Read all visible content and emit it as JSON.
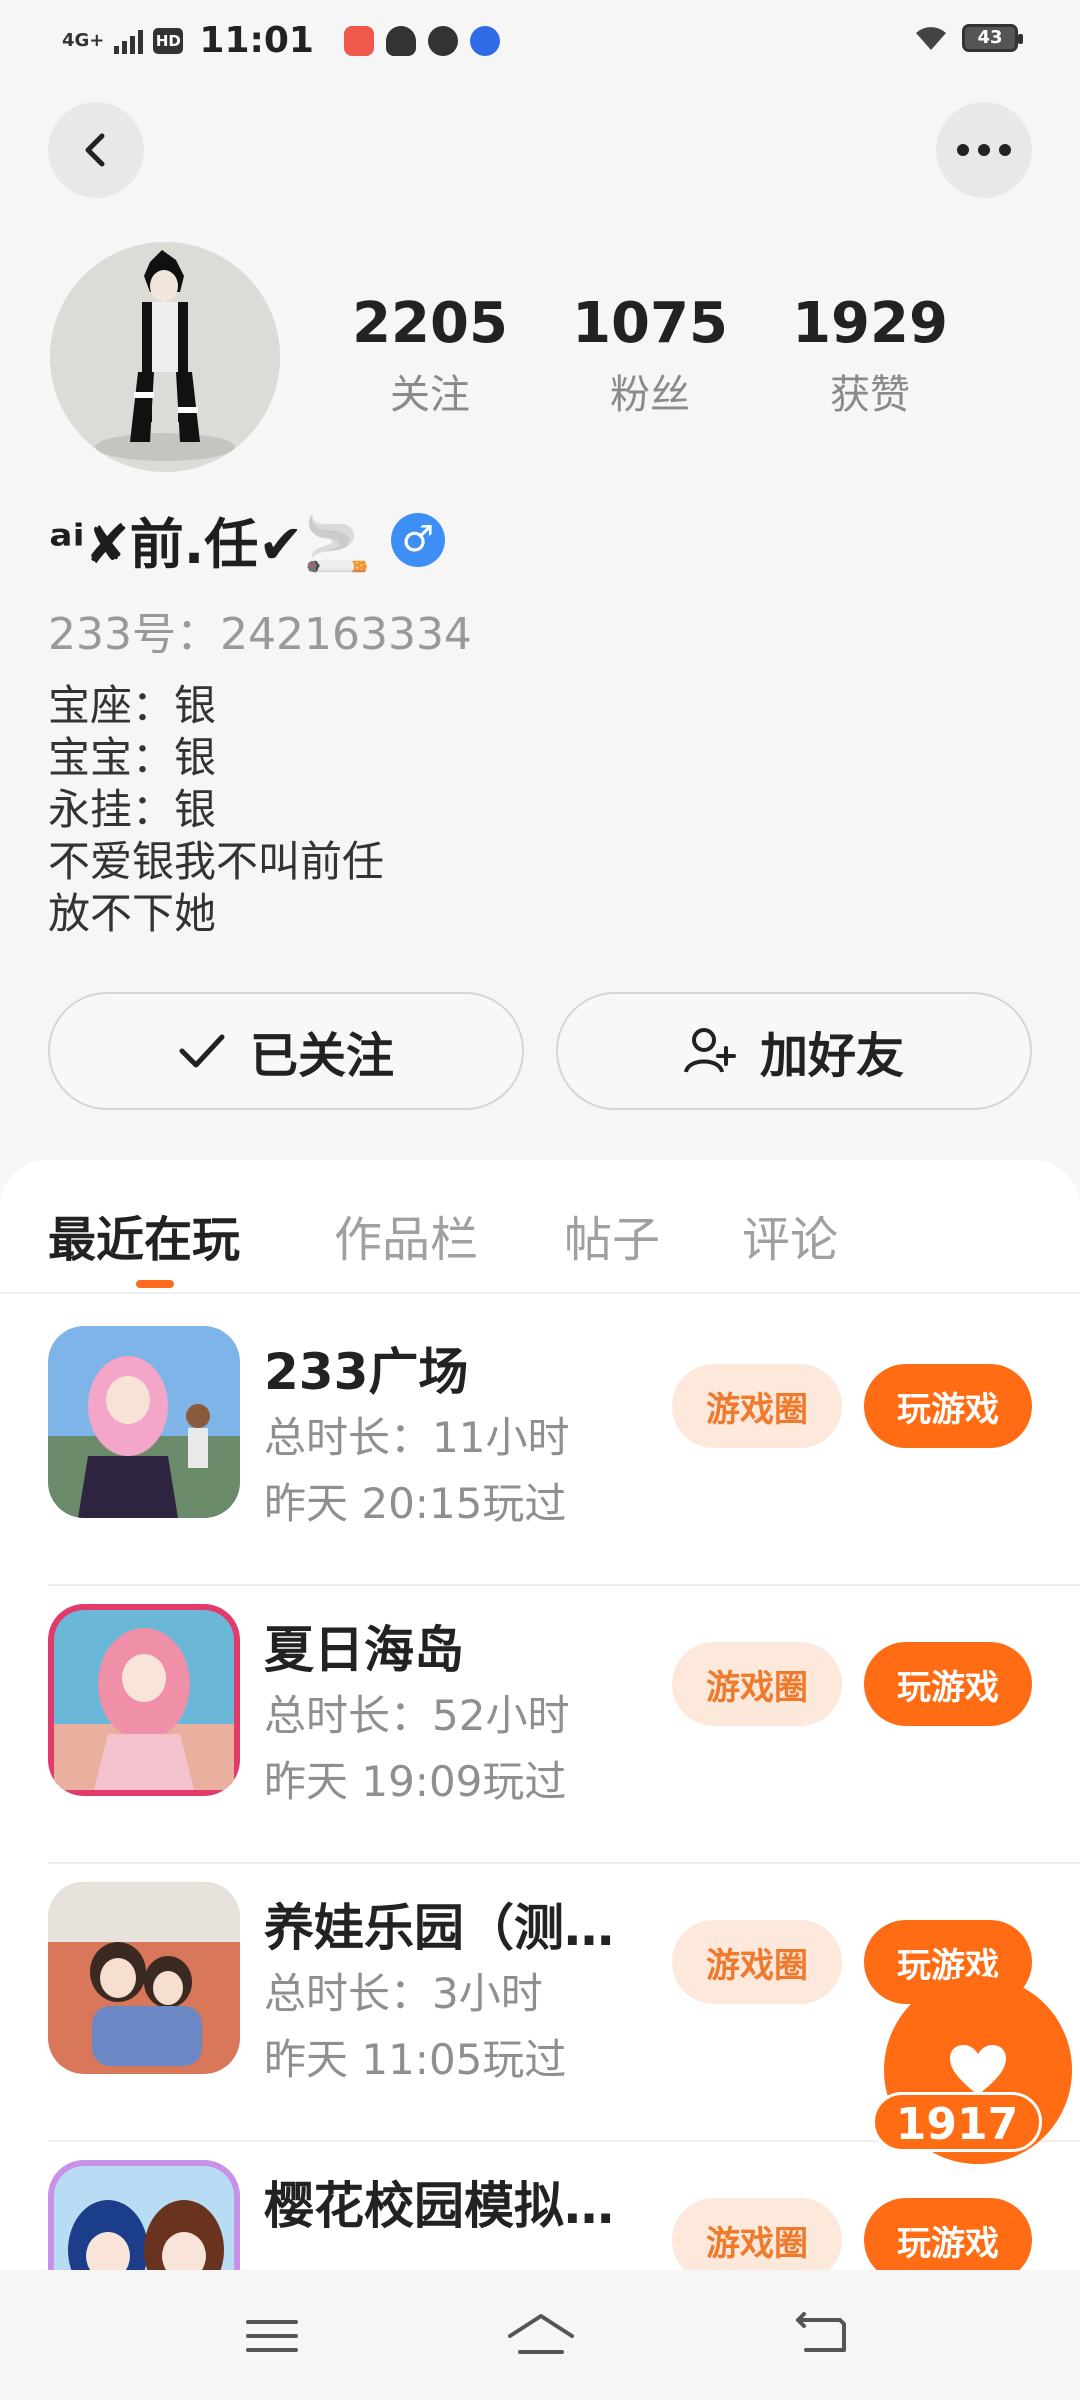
{
  "status_bar": {
    "network": "4G+",
    "hd": "HD",
    "time": "11:01",
    "battery": "43"
  },
  "profile": {
    "stats": [
      {
        "value": "2205",
        "label": "关注"
      },
      {
        "value": "1075",
        "label": "粉丝"
      },
      {
        "value": "1929",
        "label": "获赞"
      }
    ],
    "name": "ᵃⁱ✘前.任✔🚬",
    "gender": "♂",
    "uid": "233号：242163334",
    "bio": [
      "宝座：银",
      "宝宝：银",
      "永挂：银",
      "不爱银我不叫前任",
      "放不下她"
    ],
    "follow_label": "已关注",
    "add_friend_label": "加好友"
  },
  "tabs": [
    {
      "label": "最近在玩",
      "active": true
    },
    {
      "label": "作品栏",
      "active": false
    },
    {
      "label": "帖子",
      "active": false
    },
    {
      "label": "评论",
      "active": false
    }
  ],
  "games": [
    {
      "title": "233广场",
      "duration": "总时长：11小时",
      "last_played": "昨天  20:15玩过",
      "circle_label": "游戏圈",
      "play_label": "玩游戏"
    },
    {
      "title": "夏日海岛",
      "duration": "总时长：52小时",
      "last_played": "昨天  19:09玩过",
      "circle_label": "游戏圈",
      "play_label": "玩游戏"
    },
    {
      "title": "养娃乐园（测…",
      "duration": "总时长：3小时",
      "last_played": "昨天  11:05玩过",
      "circle_label": "游戏圈",
      "play_label": "玩游戏"
    },
    {
      "title": "樱花校园模拟…",
      "duration": "",
      "last_played": "",
      "circle_label": "游戏圈",
      "play_label": "玩游戏"
    }
  ],
  "like_fab": {
    "count": "1917"
  },
  "colors": {
    "accent": "#ff6c14",
    "accent_soft": "#fde8dc",
    "gender": "#3d8ff5"
  }
}
